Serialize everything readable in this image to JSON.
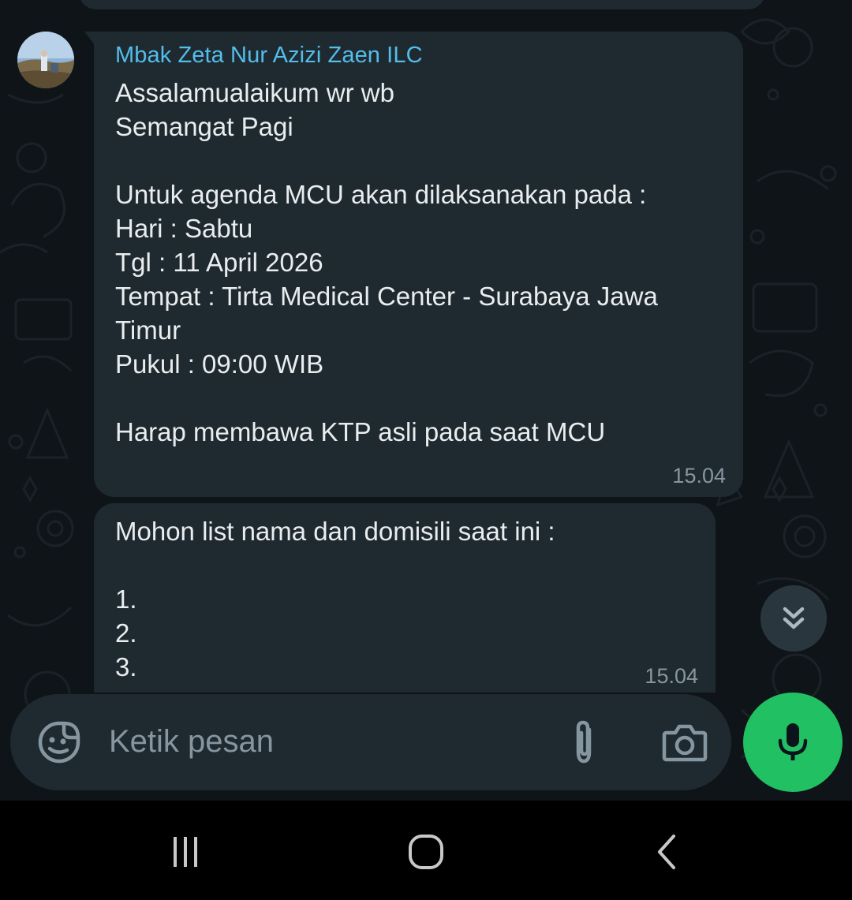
{
  "messages": [
    {
      "sender": "Mbak Zeta Nur Azizi Zaen ILC",
      "text": "Assalamualaikum wr wb\nSemangat Pagi\n\nUntuk agenda MCU akan dilaksanakan pada :\nHari : Sabtu\nTgl : 11 April 2026\nTempat : Tirta Medical Center - Surabaya Jawa Timur\nPukul : 09:00 WIB\n\nHarap membawa KTP asli pada saat MCU",
      "time": "15.04"
    },
    {
      "text": "Mohon list nama dan domisili saat ini :\n\n1.\n2.\n3.",
      "time": "15.04"
    }
  ],
  "composer": {
    "placeholder": "Ketik pesan",
    "emoji_icon": "sticker-emoji-icon",
    "attach_icon": "paperclip-icon",
    "camera_icon": "camera-icon",
    "mic_icon": "microphone-icon"
  },
  "scroll_down_icon": "double-chevron-down-icon",
  "nav": {
    "recent_icon": "recent-apps-icon",
    "home_icon": "home-icon",
    "back_icon": "back-icon"
  },
  "colors": {
    "sender_name": "#53bdeb",
    "bubble": "#1f2a30",
    "mic_button": "#21c063",
    "timestamp": "#8696a0"
  }
}
